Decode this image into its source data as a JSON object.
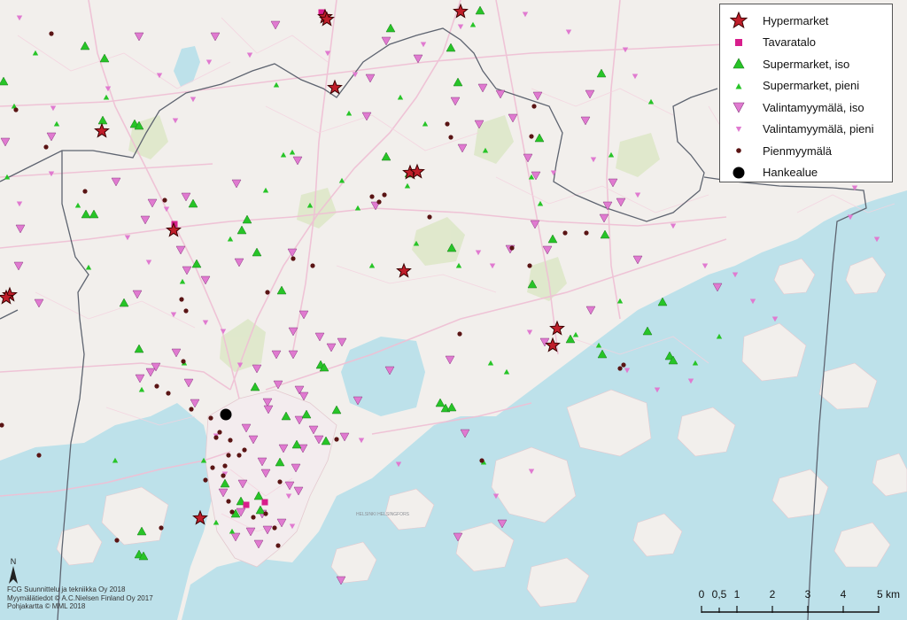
{
  "legend": {
    "items": [
      {
        "label": "Hypermarket",
        "icon": "star-icon",
        "color": "#c01e2a"
      },
      {
        "label": "Tavaratalo",
        "icon": "square-icon",
        "color": "#d81e8c"
      },
      {
        "label": "Supermarket, iso",
        "icon": "triangle-large-icon",
        "color": "#27c427"
      },
      {
        "label": "Supermarket, pieni",
        "icon": "triangle-small-icon",
        "color": "#27c427"
      },
      {
        "label": "Valintamyymälä, iso",
        "icon": "inverted-triangle-large-icon",
        "color": "#e07ad0"
      },
      {
        "label": "Valintamyymälä, pieni",
        "icon": "inverted-triangle-small-icon",
        "color": "#e07ad0"
      },
      {
        "label": "Pienmyymälä",
        "icon": "dot-icon",
        "color": "#5a1414"
      },
      {
        "label": "Hankealue",
        "icon": "black-circle-icon",
        "color": "#000000"
      }
    ]
  },
  "credits": {
    "line1": "FCG Suunnittelu ja tekniikka Oy 2018",
    "line2": "Myymälätiedot © A.C.Nielsen Finland Oy 2017",
    "line3": "Pohjakartta © MML 2018"
  },
  "north_arrow": {
    "label": "N"
  },
  "scale": {
    "ticks": [
      "0",
      "0,5",
      "1",
      "2",
      "3",
      "4",
      "5 km"
    ],
    "values_km": [
      0,
      0.5,
      1,
      2,
      3,
      4,
      5
    ]
  },
  "map_labels": {
    "district": "HELSINKI HELSINGFORS"
  },
  "colors": {
    "land": "#f2efec",
    "sea": "#bde1ea",
    "boundary": "#5e6470",
    "roads": "#f0c2d6"
  }
}
